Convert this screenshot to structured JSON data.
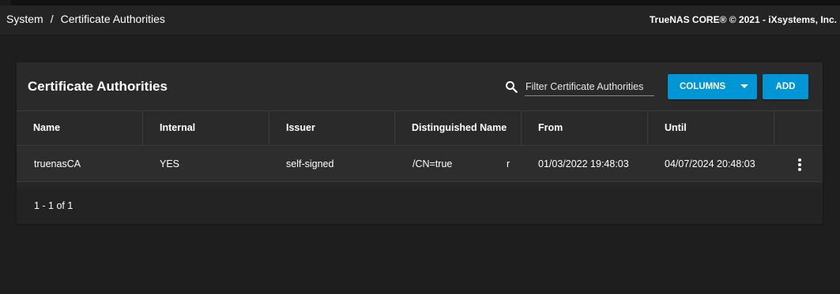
{
  "breadcrumb": {
    "items": [
      "System",
      "Certificate Authorities"
    ],
    "separator": "/"
  },
  "copyright": "TrueNAS CORE® © 2021 - iXsystems, Inc.",
  "card": {
    "title": "Certificate Authorities",
    "filter_placeholder": "Filter Certificate Authorities",
    "columns_button": "COLUMNS",
    "add_button": "ADD"
  },
  "table": {
    "headers": [
      "Name",
      "Internal",
      "Issuer",
      "Distinguished Name",
      "From",
      "Until"
    ],
    "rows": [
      {
        "name": "truenasCA",
        "internal": "YES",
        "issuer": "self-signed",
        "distinguished_name": "/CN=true",
        "distinguished_name_tail": "r",
        "from": "01/03/2022 19:48:03",
        "until": "04/07/2024 20:48:03"
      }
    ],
    "paginator": "1 - 1 of 1"
  },
  "colors": {
    "accent": "#0095d5",
    "background": "#1e1e1e",
    "card": "#2a2a2a"
  },
  "icons": [
    "search-icon",
    "chevron-down-icon",
    "more-vert-icon"
  ]
}
